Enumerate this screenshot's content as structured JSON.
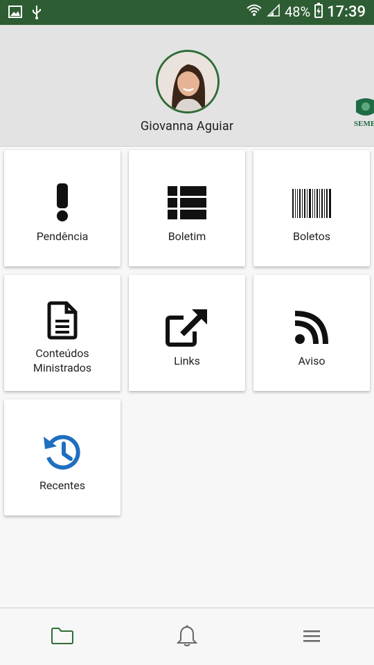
{
  "status_bar": {
    "battery": "48%",
    "time": "17:39"
  },
  "profile": {
    "name": "Giovanna Aguiar",
    "logo_text": "SEME"
  },
  "tiles": [
    {
      "label": "Pendência",
      "icon": "exclamation-icon",
      "color": "#111111"
    },
    {
      "label": "Boletim",
      "icon": "table-list-icon",
      "color": "#111111"
    },
    {
      "label": "Boletos",
      "icon": "barcode-icon",
      "color": "#111111"
    },
    {
      "label": "Conteúdos\nMinistrados",
      "icon": "document-icon",
      "color": "#111111"
    },
    {
      "label": "Links",
      "icon": "external-link-icon",
      "color": "#111111"
    },
    {
      "label": "Aviso",
      "icon": "rss-icon",
      "color": "#111111"
    },
    {
      "label": "Recentes",
      "icon": "history-icon",
      "color": "#1f6fbf"
    }
  ],
  "colors": {
    "status_bar": "#2e5d33",
    "accent": "#2f6c37",
    "recent": "#1f6fbf"
  },
  "bottom_nav": [
    {
      "icon": "folder-icon",
      "active": true
    },
    {
      "icon": "bell-icon",
      "active": false
    },
    {
      "icon": "menu-icon",
      "active": false
    }
  ]
}
